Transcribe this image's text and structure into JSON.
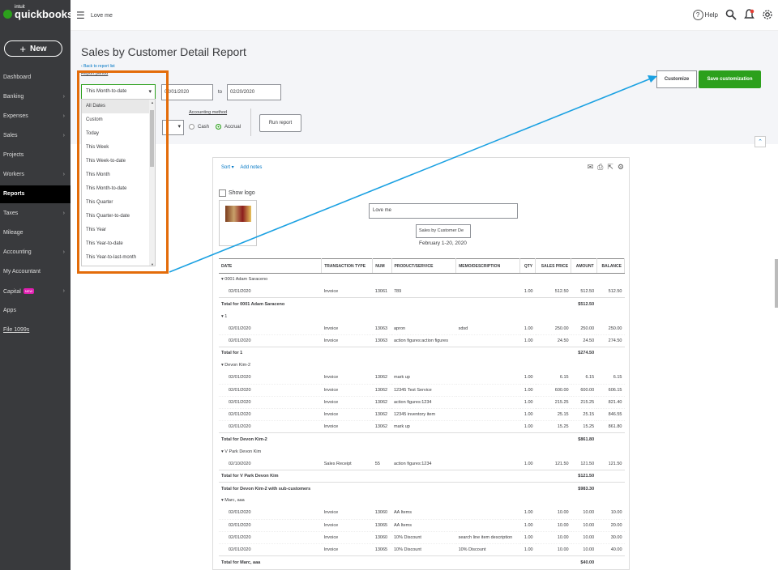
{
  "sidebar": {
    "brand": "quickbooks",
    "brand_prefix": "intuit",
    "new_button": "New",
    "items": [
      {
        "label": "Dashboard",
        "chev": false
      },
      {
        "label": "Banking",
        "chev": true
      },
      {
        "label": "Expenses",
        "chev": true
      },
      {
        "label": "Sales",
        "chev": true
      },
      {
        "label": "Projects",
        "chev": false
      },
      {
        "label": "Workers",
        "chev": true
      },
      {
        "label": "Reports",
        "chev": false
      },
      {
        "label": "Taxes",
        "chev": true
      },
      {
        "label": "Mileage",
        "chev": false
      },
      {
        "label": "Accounting",
        "chev": true
      },
      {
        "label": "My Accountant",
        "chev": false
      },
      {
        "label": "Capital",
        "chev": true,
        "badge": "NEW"
      },
      {
        "label": "Apps",
        "chev": false
      },
      {
        "label": "File 1099s",
        "chev": false
      }
    ]
  },
  "topbar": {
    "company": "Love me",
    "help": "Help"
  },
  "page": {
    "title": "Sales by Customer Detail Report",
    "back_link": "Back to report list",
    "report_period_label": "Report period",
    "period_value": "This Month-to-date",
    "date_from": "02/01/2020",
    "to_label": "to",
    "date_to": "02/20/2020",
    "accounting_method_label": "Accounting method",
    "cash_label": "Cash",
    "accrual_label": "Accrual",
    "run_report": "Run report",
    "customize": "Customize",
    "save_customization": "Save customization"
  },
  "dropdown": {
    "options": [
      "All Dates",
      "Custom",
      "Today",
      "This Week",
      "This Week-to-date",
      "This Month",
      "This Month-to-date",
      "This Quarter",
      "This Quarter-to-date",
      "This Year",
      "This Year-to-date",
      "This Year-to-last-month"
    ]
  },
  "report": {
    "sort": "Sort ▾",
    "add_notes": "Add notes",
    "show_logo": "Show logo",
    "company_name": "Love me",
    "report_title": "Sales by Customer De",
    "date_range": "February 1-20, 2020",
    "columns": [
      "DATE",
      "TRANSACTION TYPE",
      "NUM",
      "PRODUCT/SERVICE",
      "MEMO/DESCRIPTION",
      "QTY",
      "SALES PRICE",
      "AMOUNT",
      "BALANCE"
    ],
    "rows": [
      {
        "kind": "group",
        "cells": [
          "▾ 0001 Adam Saraceno",
          "",
          "",
          "",
          "",
          "",
          "",
          "",
          ""
        ]
      },
      {
        "kind": "detail",
        "cells": [
          "02/01/2020",
          "Invoice",
          "13061",
          "789",
          "",
          "1.00",
          "512.50",
          "512.50",
          "512.50"
        ]
      },
      {
        "kind": "total",
        "cells": [
          "Total for 0001 Adam Saraceno",
          "",
          "",
          "",
          "",
          "",
          "",
          "$512.50",
          ""
        ]
      },
      {
        "kind": "group",
        "cells": [
          "▾ 1",
          "",
          "",
          "",
          "",
          "",
          "",
          "",
          ""
        ]
      },
      {
        "kind": "detail",
        "cells": [
          "02/01/2020",
          "Invoice",
          "13063",
          "apron",
          "sdsd",
          "1.00",
          "250.00",
          "250.00",
          "250.00"
        ]
      },
      {
        "kind": "detail",
        "cells": [
          "02/01/2020",
          "Invoice",
          "13063",
          "action figures:action figures",
          "",
          "1.00",
          "24.50",
          "24.50",
          "274.50"
        ]
      },
      {
        "kind": "total",
        "cells": [
          "Total for 1",
          "",
          "",
          "",
          "",
          "",
          "",
          "$274.50",
          ""
        ]
      },
      {
        "kind": "group",
        "cells": [
          "▾ Devon Kim-2",
          "",
          "",
          "",
          "",
          "",
          "",
          "",
          ""
        ]
      },
      {
        "kind": "detail",
        "cells": [
          "02/01/2020",
          "Invoice",
          "13062",
          "mark up",
          "",
          "1.00",
          "6.15",
          "6.15",
          "6.15"
        ]
      },
      {
        "kind": "detail",
        "cells": [
          "02/01/2020",
          "Invoice",
          "13062",
          "12345 Test Service",
          "",
          "1.00",
          "600.00",
          "600.00",
          "606.15"
        ]
      },
      {
        "kind": "detail",
        "cells": [
          "02/01/2020",
          "Invoice",
          "13062",
          "action figures:1234",
          "",
          "1.00",
          "215.25",
          "215.25",
          "821.40"
        ]
      },
      {
        "kind": "detail",
        "cells": [
          "02/01/2020",
          "Invoice",
          "13062",
          "12345 inventory item",
          "",
          "1.00",
          "25.15",
          "25.15",
          "846.55"
        ]
      },
      {
        "kind": "detail",
        "cells": [
          "02/01/2020",
          "Invoice",
          "13062",
          "mark up",
          "",
          "1.00",
          "15.25",
          "15.25",
          "861.80"
        ]
      },
      {
        "kind": "total",
        "cells": [
          "Total for Devon Kim-2",
          "",
          "",
          "",
          "",
          "",
          "",
          "$861.80",
          ""
        ]
      },
      {
        "kind": "group",
        "cells": [
          "▾ V Park Devon Kim",
          "",
          "",
          "",
          "",
          "",
          "",
          "",
          ""
        ]
      },
      {
        "kind": "detail",
        "cells": [
          "02/10/2020",
          "Sales Receipt",
          "55",
          "action figures:1234",
          "",
          "1.00",
          "121.50",
          "121.50",
          "121.50"
        ]
      },
      {
        "kind": "total",
        "cells": [
          "Total for V Park Devon Kim",
          "",
          "",
          "",
          "",
          "",
          "",
          "$121.50",
          ""
        ]
      },
      {
        "kind": "total",
        "cells": [
          "Total for Devon Kim-2 with sub-customers",
          "",
          "",
          "",
          "",
          "",
          "",
          "$983.30",
          ""
        ]
      },
      {
        "kind": "group",
        "cells": [
          "▾ Marc, aaa",
          "",
          "",
          "",
          "",
          "",
          "",
          "",
          ""
        ]
      },
      {
        "kind": "detail",
        "cells": [
          "02/01/2020",
          "Invoice",
          "13060",
          "AA Items",
          "",
          "1.00",
          "10.00",
          "10.00",
          "10.00"
        ]
      },
      {
        "kind": "detail",
        "cells": [
          "02/01/2020",
          "Invoice",
          "13065",
          "AA Items",
          "",
          "1.00",
          "10.00",
          "10.00",
          "20.00"
        ]
      },
      {
        "kind": "detail",
        "cells": [
          "02/01/2020",
          "Invoice",
          "13060",
          "10% Discount",
          "search line item description",
          "1.00",
          "10.00",
          "10.00",
          "30.00"
        ]
      },
      {
        "kind": "detail",
        "cells": [
          "02/01/2020",
          "Invoice",
          "13065",
          "10% Discount",
          "10% Discount",
          "1.00",
          "10.00",
          "10.00",
          "40.00"
        ]
      },
      {
        "kind": "total",
        "cells": [
          "Total for Marc, aaa",
          "",
          "",
          "",
          "",
          "",
          "",
          "$40.00",
          ""
        ]
      }
    ]
  },
  "colors": {
    "brand_green": "#2ca01c",
    "sidebar_bg": "#393a3d",
    "highlight_orange": "#e36c0a",
    "annotation_arrow": "#1ba1e2"
  }
}
